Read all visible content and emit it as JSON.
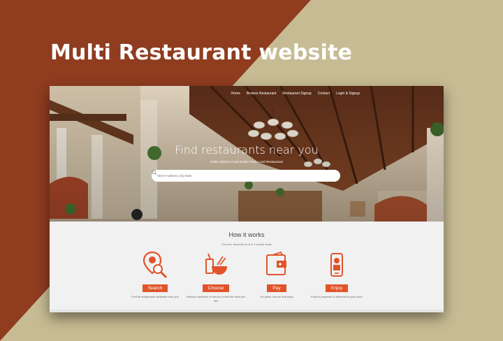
{
  "promo": {
    "title": "Multi Restaurant website"
  },
  "nav": [
    "Home",
    "Browse Restaurant",
    "Restaurant Signup",
    "Contact",
    "Login & Signup"
  ],
  "hero": {
    "title": "Find restaurants near you",
    "subtitle": "Order Delivery Food Online From Local Restaurants",
    "search_placeholder": "Street Address,City,State"
  },
  "how": {
    "title": "How it works",
    "subtitle": "Get your favourite food in 4 simple steps",
    "steps": [
      {
        "icon": "map-search-icon",
        "label": "Search",
        "desc": "Find all restaurants available near you"
      },
      {
        "icon": "food-bowl-icon",
        "label": "Choose",
        "desc": "Browse hundreds of menus to find the food you like"
      },
      {
        "icon": "wallet-icon",
        "label": "Pay",
        "desc": "It's quick, secure and easy"
      },
      {
        "icon": "delivery-icon",
        "label": "Enjoy",
        "desc": "Food is prepared & delivered to your door"
      }
    ]
  },
  "colors": {
    "accent": "#e1542a",
    "rust": "#8f3c1f",
    "sand": "#c7bb93"
  }
}
